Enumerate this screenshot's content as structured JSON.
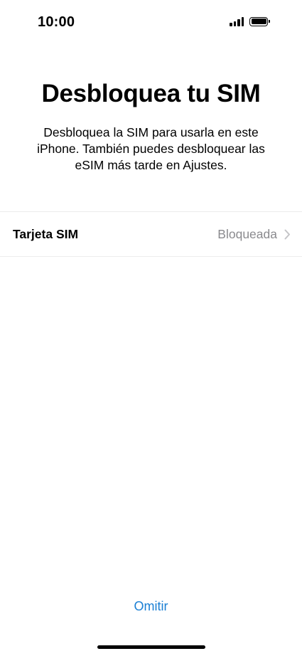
{
  "status_bar": {
    "time": "10:00",
    "signal_icon": "cellular-signal-icon",
    "battery_icon": "battery-full-icon"
  },
  "header": {
    "title": "Desbloquea tu SIM",
    "subtitle": "Desbloquea la SIM para usarla en este iPhone. También puedes desbloquear las eSIM más tarde en Ajustes."
  },
  "sim_row": {
    "label": "Tarjeta SIM",
    "value": "Bloqueada",
    "chevron_icon": "chevron-right-icon"
  },
  "footer": {
    "skip_label": "Omitir"
  },
  "colors": {
    "accent": "#1a7fd4",
    "secondary_text": "#8a8a8e",
    "separator": "#ececec"
  }
}
